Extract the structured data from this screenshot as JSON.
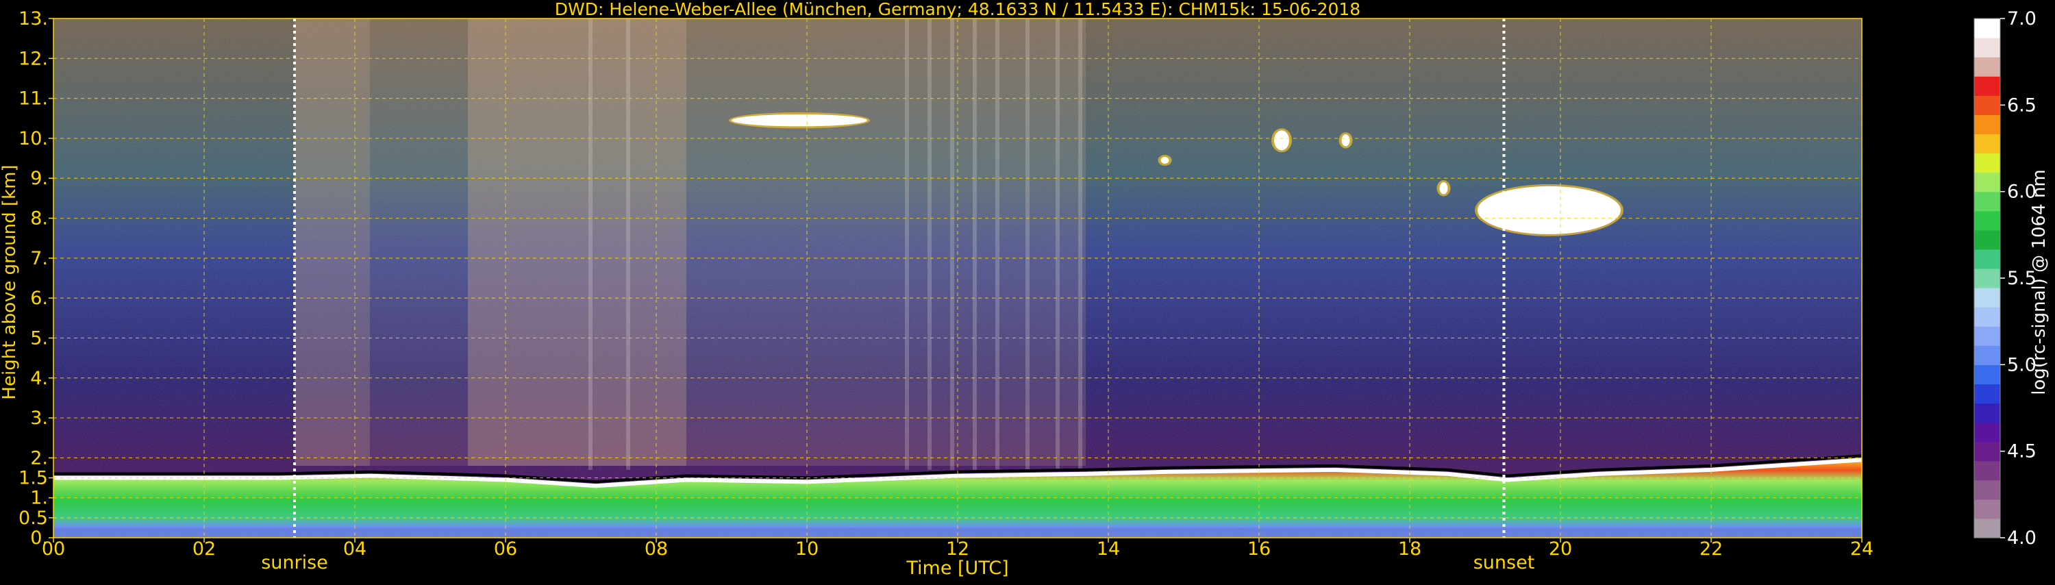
{
  "chart_data": {
    "type": "heatmap",
    "title": "DWD: Helene-Weber-Allee (München, Germany; 48.1633 N / 11.5433 E):    CHM15k: 15-06-2018",
    "xlabel": "Time [UTC]",
    "ylabel": "Height above ground [km]",
    "colorbar_label": "log(rc-signal) @ 1064 nm",
    "xlim": [
      0,
      24
    ],
    "ylim": [
      0,
      13
    ],
    "clim": [
      4.0,
      7.0
    ],
    "x_ticks": [
      {
        "value": 0,
        "label": "00"
      },
      {
        "value": 2,
        "label": "02"
      },
      {
        "value": 4,
        "label": "04"
      },
      {
        "value": 6,
        "label": "06"
      },
      {
        "value": 8,
        "label": "08"
      },
      {
        "value": 10,
        "label": "10"
      },
      {
        "value": 12,
        "label": "12"
      },
      {
        "value": 14,
        "label": "14"
      },
      {
        "value": 16,
        "label": "16"
      },
      {
        "value": 18,
        "label": "18"
      },
      {
        "value": 20,
        "label": "20"
      },
      {
        "value": 22,
        "label": "22"
      },
      {
        "value": 24,
        "label": "24"
      }
    ],
    "y_ticks": [
      {
        "value": 0,
        "label": "0."
      },
      {
        "value": 0.5,
        "label": "0.5"
      },
      {
        "value": 1,
        "label": "1."
      },
      {
        "value": 1.5,
        "label": "1.5"
      },
      {
        "value": 2,
        "label": "2."
      },
      {
        "value": 3,
        "label": "3."
      },
      {
        "value": 4,
        "label": "4."
      },
      {
        "value": 5,
        "label": "5."
      },
      {
        "value": 6,
        "label": "6."
      },
      {
        "value": 7,
        "label": "7."
      },
      {
        "value": 8,
        "label": "8."
      },
      {
        "value": 9,
        "label": "9."
      },
      {
        "value": 10,
        "label": "10."
      },
      {
        "value": 11,
        "label": "11."
      },
      {
        "value": 12,
        "label": "12."
      },
      {
        "value": 13,
        "label": "13."
      }
    ],
    "colorbar_ticks": [
      {
        "value": 4.0,
        "label": "4.0"
      },
      {
        "value": 4.5,
        "label": "4.5"
      },
      {
        "value": 5.0,
        "label": "5.0"
      },
      {
        "value": 5.5,
        "label": "5.5"
      },
      {
        "value": 6.0,
        "label": "6.0"
      },
      {
        "value": 6.5,
        "label": "6.5"
      },
      {
        "value": 7.0,
        "label": "7.0"
      }
    ],
    "colorbar_colors": [
      "#a89aa6",
      "#a07a98",
      "#8f5a8c",
      "#7a3a86",
      "#6a1e8c",
      "#5a14a0",
      "#3a20b8",
      "#2a40d8",
      "#3a6cf0",
      "#6a90f4",
      "#8aa8f6",
      "#a8c4f8",
      "#b8d8f4",
      "#7cd8a8",
      "#40c880",
      "#20b040",
      "#30c848",
      "#60d860",
      "#a0e860",
      "#d8f030",
      "#f8c020",
      "#f89018",
      "#f05020",
      "#e82020",
      "#d8b0a8",
      "#f0e0e0",
      "#ffffff"
    ],
    "markers": [
      {
        "x": 3.2,
        "label": "sunrise"
      },
      {
        "x": 19.25,
        "label": "sunset"
      }
    ],
    "grid": true,
    "features": {
      "boundary_layer_top_km": [
        [
          0,
          1.5
        ],
        [
          3,
          1.5
        ],
        [
          4.2,
          1.55
        ],
        [
          6,
          1.45
        ],
        [
          7.2,
          1.3
        ],
        [
          8.4,
          1.45
        ],
        [
          10,
          1.4
        ],
        [
          12,
          1.55
        ],
        [
          13.7,
          1.6
        ],
        [
          14.8,
          1.65
        ],
        [
          17,
          1.7
        ],
        [
          18.5,
          1.6
        ],
        [
          19.3,
          1.45
        ],
        [
          20.5,
          1.6
        ],
        [
          22,
          1.7
        ],
        [
          24,
          1.95
        ]
      ],
      "clouds": [
        {
          "x": [
            9.0,
            10.8
          ],
          "height_km": [
            10.3,
            10.6
          ]
        },
        {
          "x": [
            14.7,
            14.8
          ],
          "height_km": [
            9.4,
            9.5
          ]
        },
        {
          "x": [
            16.2,
            16.4
          ],
          "height_km": [
            9.7,
            10.2
          ]
        },
        {
          "x": [
            17.1,
            17.2
          ],
          "height_km": [
            9.8,
            10.1
          ]
        },
        {
          "x": [
            18.4,
            18.5
          ],
          "height_km": [
            8.6,
            8.9
          ]
        },
        {
          "x": [
            18.9,
            20.8
          ],
          "height_km": [
            7.6,
            8.8
          ]
        }
      ]
    }
  }
}
